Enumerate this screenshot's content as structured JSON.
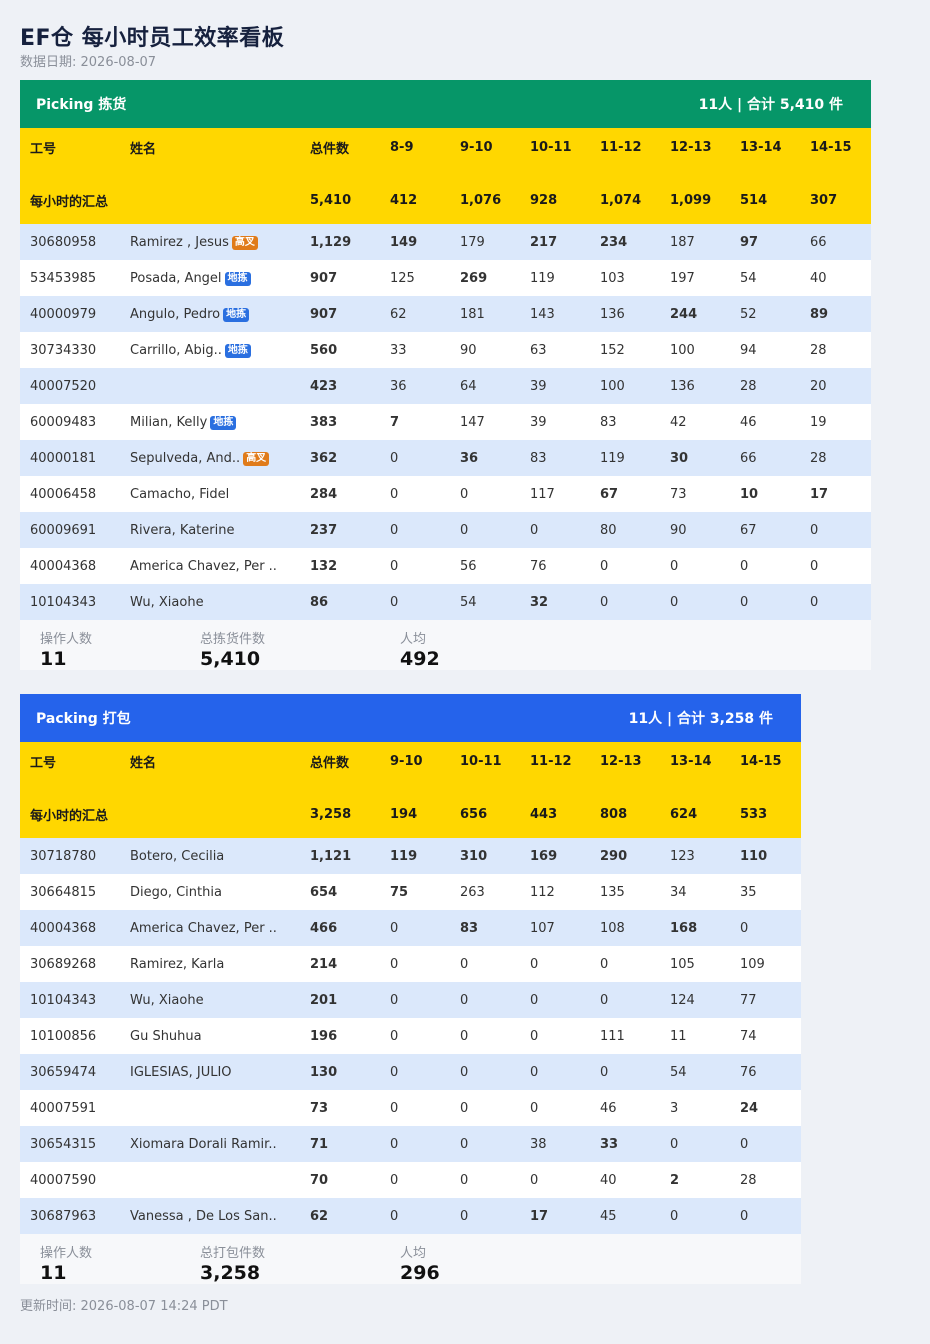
{
  "title": "EF仓 每小时员工效率看板",
  "subtitle": "数据日期: 2026-08-07",
  "updated": "更新时间: 2026-08-07 14:24 PDT",
  "colors": {
    "picking": "#069668",
    "packing": "#2563eb",
    "header_row": "#ffd700",
    "high": "#16a34a",
    "low": "#e23b3b"
  },
  "picking": {
    "header_title": "Picking 拣货",
    "header_summary": "11人 | 合计 5,410 件",
    "columns": [
      "工号",
      "姓名",
      "总件数",
      "8-9",
      "9-10",
      "10-11",
      "11-12",
      "12-13",
      "13-14",
      "14-15"
    ],
    "summary_label": "每小时的汇总",
    "summary_values": [
      "5,410",
      "412",
      "1,076",
      "928",
      "1,074",
      "1,099",
      "514",
      "307"
    ],
    "rows": [
      {
        "id": "30680958",
        "name": "Ramirez , Jesus",
        "tag": "高叉",
        "tag_type": "gao",
        "total": "1,129",
        "hours": [
          "149",
          "179",
          "217",
          "234",
          "187",
          "97",
          "66"
        ],
        "marks": [
          "h",
          "",
          "h",
          "h",
          "",
          "h",
          ""
        ]
      },
      {
        "id": "53453985",
        "name": "Posada, Angel",
        "tag": "地拣",
        "tag_type": "di",
        "total": "907",
        "hours": [
          "125",
          "269",
          "119",
          "103",
          "197",
          "54",
          "40"
        ],
        "marks": [
          "",
          "h",
          "",
          "",
          "",
          "",
          ""
        ]
      },
      {
        "id": "40000979",
        "name": "Angulo, Pedro",
        "tag": "地拣",
        "tag_type": "di",
        "total": "907",
        "hours": [
          "62",
          "181",
          "143",
          "136",
          "244",
          "52",
          "89"
        ],
        "marks": [
          "",
          "",
          "",
          "",
          "h",
          "",
          "h"
        ]
      },
      {
        "id": "30734330",
        "name": "Carrillo, Abig..",
        "tag": "地拣",
        "tag_type": "di",
        "total": "560",
        "hours": [
          "33",
          "90",
          "63",
          "152",
          "100",
          "94",
          "28"
        ],
        "marks": [
          "",
          "",
          "",
          "",
          "",
          "",
          ""
        ]
      },
      {
        "id": "40007520",
        "name": "",
        "tag": "",
        "tag_type": "",
        "total": "423",
        "hours": [
          "36",
          "64",
          "39",
          "100",
          "136",
          "28",
          "20"
        ],
        "marks": [
          "",
          "",
          "",
          "",
          "",
          "",
          ""
        ]
      },
      {
        "id": "60009483",
        "name": "Milian, Kelly",
        "tag": "地拣",
        "tag_type": "di",
        "total": "383",
        "hours": [
          "7",
          "147",
          "39",
          "83",
          "42",
          "46",
          "19"
        ],
        "marks": [
          "l",
          "",
          "",
          "",
          "",
          "",
          ""
        ]
      },
      {
        "id": "40000181",
        "name": "Sepulveda, And..",
        "tag": "高叉",
        "tag_type": "gao",
        "total": "362",
        "hours": [
          "0",
          "36",
          "83",
          "119",
          "30",
          "66",
          "28"
        ],
        "marks": [
          "z",
          "l",
          "",
          "",
          "l",
          "",
          ""
        ]
      },
      {
        "id": "40006458",
        "name": "Camacho, Fidel",
        "tag": "",
        "tag_type": "",
        "total": "284",
        "hours": [
          "0",
          "0",
          "117",
          "67",
          "73",
          "10",
          "17"
        ],
        "marks": [
          "z",
          "z",
          "",
          "l",
          "",
          "l",
          "l"
        ]
      },
      {
        "id": "60009691",
        "name": "Rivera, Katerine",
        "tag": "",
        "tag_type": "",
        "total": "237",
        "hours": [
          "0",
          "0",
          "0",
          "80",
          "90",
          "67",
          "0"
        ],
        "marks": [
          "z",
          "z",
          "z",
          "",
          "",
          "",
          "z"
        ]
      },
      {
        "id": "40004368",
        "name": "America Chavez, Per ..",
        "tag": "",
        "tag_type": "",
        "total": "132",
        "hours": [
          "0",
          "56",
          "76",
          "0",
          "0",
          "0",
          "0"
        ],
        "marks": [
          "z",
          "",
          "",
          "z",
          "z",
          "z",
          "z"
        ]
      },
      {
        "id": "10104343",
        "name": "Wu, Xiaohe",
        "tag": "",
        "tag_type": "",
        "total": "86",
        "hours": [
          "0",
          "54",
          "32",
          "0",
          "0",
          "0",
          "0"
        ],
        "marks": [
          "z",
          "",
          "l",
          "z",
          "z",
          "z",
          "z"
        ]
      }
    ],
    "footer": [
      {
        "label": "操作人数",
        "value": "11"
      },
      {
        "label": "总拣货件数",
        "value": "5,410"
      },
      {
        "label": "人均",
        "value": "492"
      }
    ]
  },
  "packing": {
    "header_title": "Packing 打包",
    "header_summary": "11人 | 合计 3,258 件",
    "columns": [
      "工号",
      "姓名",
      "总件数",
      "9-10",
      "10-11",
      "11-12",
      "12-13",
      "13-14",
      "14-15"
    ],
    "summary_label": "每小时的汇总",
    "summary_values": [
      "3,258",
      "194",
      "656",
      "443",
      "808",
      "624",
      "533"
    ],
    "rows": [
      {
        "id": "30718780",
        "name": "Botero, Cecilia",
        "total": "1,121",
        "hours": [
          "119",
          "310",
          "169",
          "290",
          "123",
          "110"
        ],
        "marks": [
          "h",
          "h",
          "h",
          "h",
          "",
          "h"
        ]
      },
      {
        "id": "30664815",
        "name": "Diego, Cinthia",
        "total": "654",
        "hours": [
          "75",
          "263",
          "112",
          "135",
          "34",
          "35"
        ],
        "marks": [
          "l",
          "",
          "",
          "",
          "",
          ""
        ]
      },
      {
        "id": "40004368",
        "name": "America Chavez, Per ..",
        "total": "466",
        "hours": [
          "0",
          "83",
          "107",
          "108",
          "168",
          "0"
        ],
        "marks": [
          "z",
          "l",
          "",
          "",
          "h",
          "z"
        ]
      },
      {
        "id": "30689268",
        "name": "Ramirez, Karla",
        "total": "214",
        "hours": [
          "0",
          "0",
          "0",
          "0",
          "105",
          "109"
        ],
        "marks": [
          "z",
          "z",
          "z",
          "z",
          "",
          ""
        ]
      },
      {
        "id": "10104343",
        "name": "Wu, Xiaohe",
        "total": "201",
        "hours": [
          "0",
          "0",
          "0",
          "0",
          "124",
          "77"
        ],
        "marks": [
          "z",
          "z",
          "z",
          "z",
          "",
          ""
        ]
      },
      {
        "id": "10100856",
        "name": "Gu Shuhua",
        "total": "196",
        "hours": [
          "0",
          "0",
          "0",
          "111",
          "11",
          "74"
        ],
        "marks": [
          "z",
          "z",
          "z",
          "",
          "",
          ""
        ]
      },
      {
        "id": "30659474",
        "name": "IGLESIAS, JULIO",
        "total": "130",
        "hours": [
          "0",
          "0",
          "0",
          "0",
          "54",
          "76"
        ],
        "marks": [
          "z",
          "z",
          "z",
          "z",
          "",
          ""
        ]
      },
      {
        "id": "40007591",
        "name": "",
        "total": "73",
        "hours": [
          "0",
          "0",
          "0",
          "46",
          "3",
          "24"
        ],
        "marks": [
          "z",
          "z",
          "z",
          "",
          "",
          "l"
        ]
      },
      {
        "id": "30654315",
        "name": "Xiomara Dorali Ramir..",
        "total": "71",
        "hours": [
          "0",
          "0",
          "38",
          "33",
          "0",
          "0"
        ],
        "marks": [
          "z",
          "z",
          "",
          "l",
          "z",
          "z"
        ]
      },
      {
        "id": "40007590",
        "name": "",
        "total": "70",
        "hours": [
          "0",
          "0",
          "0",
          "40",
          "2",
          "28"
        ],
        "marks": [
          "z",
          "z",
          "z",
          "",
          "l",
          ""
        ]
      },
      {
        "id": "30687963",
        "name": "Vanessa , De Los San..",
        "total": "62",
        "hours": [
          "0",
          "0",
          "17",
          "45",
          "0",
          "0"
        ],
        "marks": [
          "z",
          "z",
          "l",
          "",
          "z",
          "z"
        ]
      }
    ],
    "footer": [
      {
        "label": "操作人数",
        "value": "11"
      },
      {
        "label": "总打包件数",
        "value": "3,258"
      },
      {
        "label": "人均",
        "value": "296"
      }
    ]
  }
}
